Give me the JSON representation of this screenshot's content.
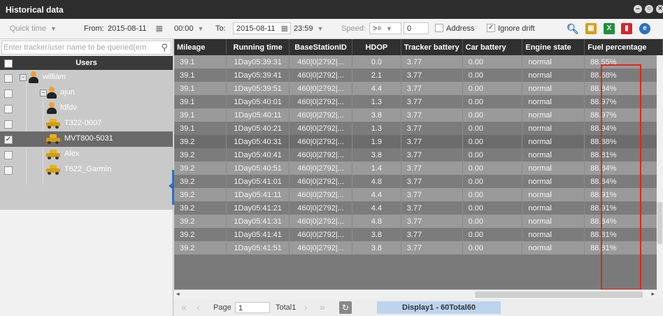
{
  "window": {
    "title": "Historical data",
    "controls": [
      "minimize-icon",
      "restore-icon",
      "close-icon"
    ]
  },
  "toolbar": {
    "quick_time": "Quick time",
    "from_label": "From:",
    "from_date": "2015-08-11",
    "from_time": "00:00",
    "to_label": "To:",
    "to_date": "2015-08-11",
    "to_time": "23:59",
    "speed_label": "Speed:",
    "speed_op": ">=",
    "speed_value": "0",
    "address_label": "Address",
    "ignore_drift_label": "Ignore drift",
    "ignore_drift_checked": true,
    "address_checked": false,
    "icons": [
      "search-icon",
      "map-icon",
      "excel-icon",
      "pdf-icon",
      "ie-icon"
    ]
  },
  "sidebar": {
    "search_placeholder": "Enter tracker/user name to be queried(em",
    "users_header": "Users",
    "tree": [
      {
        "label": "william",
        "type": "user",
        "level": 0,
        "expanded": true,
        "checked": false
      },
      {
        "label": "ajun",
        "type": "user",
        "level": 1,
        "expanded": true,
        "checked": false
      },
      {
        "label": "fdfdv",
        "type": "user",
        "level": 1,
        "checked": false
      },
      {
        "label": "T322-0007",
        "type": "car",
        "level": 2,
        "checked": false
      },
      {
        "label": "MVT800-5031",
        "type": "car",
        "level": 2,
        "checked": true,
        "selected": true
      },
      {
        "label": "Alex",
        "type": "car",
        "level": 2,
        "checked": false
      },
      {
        "label": "T622_Garmin",
        "type": "car",
        "level": 2,
        "checked": false
      }
    ]
  },
  "table": {
    "columns": [
      "Mileage",
      "Running time",
      "BaseStationID",
      "HDOP",
      "Tracker battery",
      "Car battery",
      "Engine state",
      "Fuel percentage"
    ],
    "rows": [
      [
        "39.1",
        "1Day05:39:31",
        "460|0|2792|...",
        "0.0",
        "3.77",
        "0.00",
        "normal",
        "88.55%"
      ],
      [
        "39.1",
        "1Day05:39:41",
        "460|0|2792|...",
        "2.1",
        "3.77",
        "0.00",
        "normal",
        "88.68%"
      ],
      [
        "39.1",
        "1Day05:39:51",
        "460|0|2792|...",
        "4.4",
        "3.77",
        "0.00",
        "normal",
        "88.84%"
      ],
      [
        "39.1",
        "1Day05:40:01",
        "460|0|2792|...",
        "1.3",
        "3.77",
        "0.00",
        "normal",
        "88.97%"
      ],
      [
        "39.1",
        "1Day05:40:11",
        "460|0|2792|...",
        "3.8",
        "3.77",
        "0.00",
        "normal",
        "88.97%"
      ],
      [
        "39.1",
        "1Day05:40:21",
        "460|0|2792|...",
        "1.3",
        "3.77",
        "0.00",
        "normal",
        "88.94%"
      ],
      [
        "39.2",
        "1Day05:40:31",
        "460|0|2792|...",
        "1.9",
        "3.77",
        "0.00",
        "normal",
        "88.88%"
      ],
      [
        "39.2",
        "1Day05:40:41",
        "460|0|2792|...",
        "3.8",
        "3.77",
        "0.00",
        "normal",
        "88.81%"
      ],
      [
        "39.2",
        "1Day05:40:51",
        "460|0|2792|...",
        "1.4",
        "3.77",
        "0.00",
        "normal",
        "88.84%"
      ],
      [
        "39.2",
        "1Day05:41:01",
        "460|0|2792|...",
        "4.8",
        "3.77",
        "0.00",
        "normal",
        "88.84%"
      ],
      [
        "39.2",
        "1Day05:41:11",
        "460|0|2792|...",
        "4.4",
        "3.77",
        "0.00",
        "normal",
        "88.91%"
      ],
      [
        "39.2",
        "1Day05:41:21",
        "460|0|2792|...",
        "4.4",
        "3.77",
        "0.00",
        "normal",
        "88.91%"
      ],
      [
        "39.2",
        "1Day05:41:31",
        "460|0|2792|...",
        "4.8",
        "3.77",
        "0.00",
        "normal",
        "88.84%"
      ],
      [
        "39.2",
        "1Day05:41:41",
        "460|0|2792|...",
        "3.8",
        "3.77",
        "0.00",
        "normal",
        "88.81%"
      ],
      [
        "39.2",
        "1Day05:41:51",
        "460|0|2792|...",
        "3.8",
        "3.77",
        "0.00",
        "normal",
        "88.81%"
      ]
    ]
  },
  "pager": {
    "page_label": "Page",
    "page_value": "1",
    "total_label": "Total1",
    "display_text": "Display1 - 60Total60"
  },
  "colors": {
    "titlebar": "#2d2d2d",
    "highlight": "#e0261b",
    "accent": "#2c6fc5"
  }
}
